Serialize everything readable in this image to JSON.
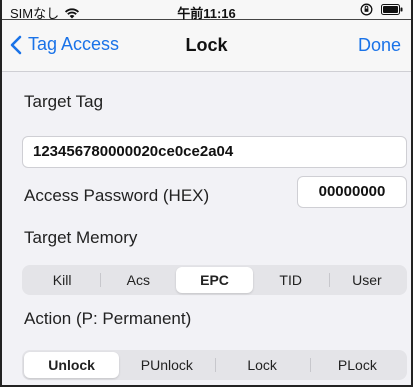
{
  "status_bar": {
    "carrier": "SIMなし",
    "time": "午前11:16"
  },
  "nav": {
    "back_label": "Tag Access",
    "title": "Lock",
    "done_label": "Done"
  },
  "target_tag": {
    "label": "Target Tag",
    "value": "123456780000020ce0ce2a04"
  },
  "access_password": {
    "label": "Access Password (HEX)",
    "value": "00000000"
  },
  "target_memory": {
    "label": "Target Memory",
    "options": [
      "Kill",
      "Acs",
      "EPC",
      "TID",
      "User"
    ],
    "selected": "EPC"
  },
  "action": {
    "label": "Action (P: Permanent)",
    "options": [
      "Unlock",
      "PUnlock",
      "Lock",
      "PLock"
    ],
    "selected": "Unlock"
  },
  "colors": {
    "accent": "#1a73e8",
    "background": "#f2f2f6"
  },
  "icons": [
    "wifi-icon",
    "orientation-lock-icon",
    "battery-icon",
    "chevron-left-icon"
  ]
}
